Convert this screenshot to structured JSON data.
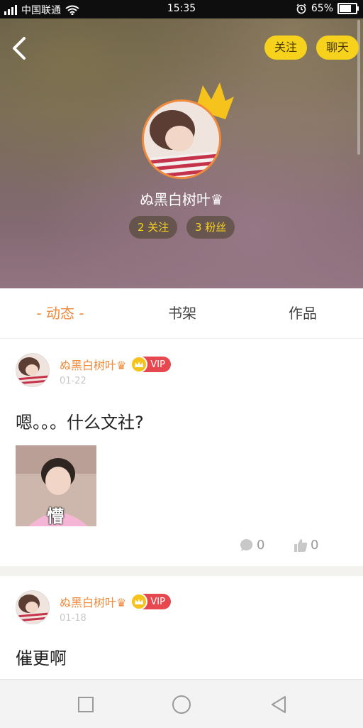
{
  "status_bar": {
    "carrier": "中国联通",
    "time": "15:35",
    "battery_percent": "65%",
    "battery_level": 0.65
  },
  "header": {
    "follow_button": "关注",
    "chat_button": "聊天",
    "profile_name": "ぬ黑白树叶♛",
    "following": "2 关注",
    "followers": "3 粉丝"
  },
  "tabs": [
    {
      "label": "- 动态 -",
      "active": true
    },
    {
      "label": "书架",
      "active": false
    },
    {
      "label": "作品",
      "active": false
    }
  ],
  "posts": [
    {
      "user": "ぬ黑白树叶♛",
      "vip": "VIP",
      "date": "01-22",
      "text": "嗯。。。什么文社?",
      "image_caption": "懵",
      "comments": "0",
      "likes": "0"
    },
    {
      "user": "ぬ黑白树叶♛",
      "vip": "VIP",
      "date": "01-18",
      "text": "催更啊"
    }
  ],
  "colors": {
    "accent_orange": "#f08a3c",
    "yellow": "#f6d21c",
    "vip_red": "#e7474f"
  }
}
